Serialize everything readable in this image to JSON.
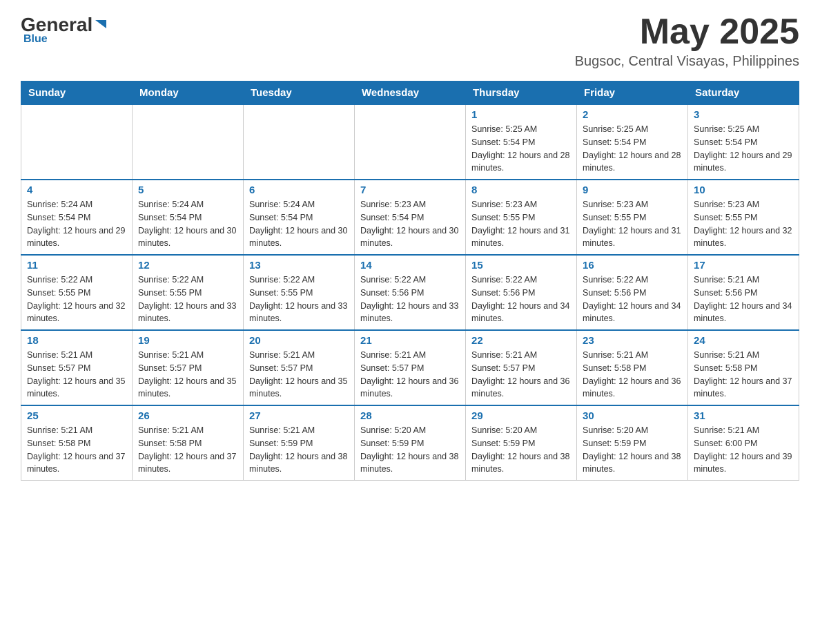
{
  "header": {
    "logo": {
      "general": "General",
      "triangle": "▶",
      "blue": "Blue"
    },
    "title": "May 2025",
    "location": "Bugsoc, Central Visayas, Philippines"
  },
  "days_of_week": [
    "Sunday",
    "Monday",
    "Tuesday",
    "Wednesday",
    "Thursday",
    "Friday",
    "Saturday"
  ],
  "weeks": [
    [
      {
        "day": "",
        "info": ""
      },
      {
        "day": "",
        "info": ""
      },
      {
        "day": "",
        "info": ""
      },
      {
        "day": "",
        "info": ""
      },
      {
        "day": "1",
        "sunrise": "5:25 AM",
        "sunset": "5:54 PM",
        "daylight": "12 hours and 28 minutes."
      },
      {
        "day": "2",
        "sunrise": "5:25 AM",
        "sunset": "5:54 PM",
        "daylight": "12 hours and 28 minutes."
      },
      {
        "day": "3",
        "sunrise": "5:25 AM",
        "sunset": "5:54 PM",
        "daylight": "12 hours and 29 minutes."
      }
    ],
    [
      {
        "day": "4",
        "sunrise": "5:24 AM",
        "sunset": "5:54 PM",
        "daylight": "12 hours and 29 minutes."
      },
      {
        "day": "5",
        "sunrise": "5:24 AM",
        "sunset": "5:54 PM",
        "daylight": "12 hours and 30 minutes."
      },
      {
        "day": "6",
        "sunrise": "5:24 AM",
        "sunset": "5:54 PM",
        "daylight": "12 hours and 30 minutes."
      },
      {
        "day": "7",
        "sunrise": "5:23 AM",
        "sunset": "5:54 PM",
        "daylight": "12 hours and 30 minutes."
      },
      {
        "day": "8",
        "sunrise": "5:23 AM",
        "sunset": "5:55 PM",
        "daylight": "12 hours and 31 minutes."
      },
      {
        "day": "9",
        "sunrise": "5:23 AM",
        "sunset": "5:55 PM",
        "daylight": "12 hours and 31 minutes."
      },
      {
        "day": "10",
        "sunrise": "5:23 AM",
        "sunset": "5:55 PM",
        "daylight": "12 hours and 32 minutes."
      }
    ],
    [
      {
        "day": "11",
        "sunrise": "5:22 AM",
        "sunset": "5:55 PM",
        "daylight": "12 hours and 32 minutes."
      },
      {
        "day": "12",
        "sunrise": "5:22 AM",
        "sunset": "5:55 PM",
        "daylight": "12 hours and 33 minutes."
      },
      {
        "day": "13",
        "sunrise": "5:22 AM",
        "sunset": "5:55 PM",
        "daylight": "12 hours and 33 minutes."
      },
      {
        "day": "14",
        "sunrise": "5:22 AM",
        "sunset": "5:56 PM",
        "daylight": "12 hours and 33 minutes."
      },
      {
        "day": "15",
        "sunrise": "5:22 AM",
        "sunset": "5:56 PM",
        "daylight": "12 hours and 34 minutes."
      },
      {
        "day": "16",
        "sunrise": "5:22 AM",
        "sunset": "5:56 PM",
        "daylight": "12 hours and 34 minutes."
      },
      {
        "day": "17",
        "sunrise": "5:21 AM",
        "sunset": "5:56 PM",
        "daylight": "12 hours and 34 minutes."
      }
    ],
    [
      {
        "day": "18",
        "sunrise": "5:21 AM",
        "sunset": "5:57 PM",
        "daylight": "12 hours and 35 minutes."
      },
      {
        "day": "19",
        "sunrise": "5:21 AM",
        "sunset": "5:57 PM",
        "daylight": "12 hours and 35 minutes."
      },
      {
        "day": "20",
        "sunrise": "5:21 AM",
        "sunset": "5:57 PM",
        "daylight": "12 hours and 35 minutes."
      },
      {
        "day": "21",
        "sunrise": "5:21 AM",
        "sunset": "5:57 PM",
        "daylight": "12 hours and 36 minutes."
      },
      {
        "day": "22",
        "sunrise": "5:21 AM",
        "sunset": "5:57 PM",
        "daylight": "12 hours and 36 minutes."
      },
      {
        "day": "23",
        "sunrise": "5:21 AM",
        "sunset": "5:58 PM",
        "daylight": "12 hours and 36 minutes."
      },
      {
        "day": "24",
        "sunrise": "5:21 AM",
        "sunset": "5:58 PM",
        "daylight": "12 hours and 37 minutes."
      }
    ],
    [
      {
        "day": "25",
        "sunrise": "5:21 AM",
        "sunset": "5:58 PM",
        "daylight": "12 hours and 37 minutes."
      },
      {
        "day": "26",
        "sunrise": "5:21 AM",
        "sunset": "5:58 PM",
        "daylight": "12 hours and 37 minutes."
      },
      {
        "day": "27",
        "sunrise": "5:21 AM",
        "sunset": "5:59 PM",
        "daylight": "12 hours and 38 minutes."
      },
      {
        "day": "28",
        "sunrise": "5:20 AM",
        "sunset": "5:59 PM",
        "daylight": "12 hours and 38 minutes."
      },
      {
        "day": "29",
        "sunrise": "5:20 AM",
        "sunset": "5:59 PM",
        "daylight": "12 hours and 38 minutes."
      },
      {
        "day": "30",
        "sunrise": "5:20 AM",
        "sunset": "5:59 PM",
        "daylight": "12 hours and 38 minutes."
      },
      {
        "day": "31",
        "sunrise": "5:21 AM",
        "sunset": "6:00 PM",
        "daylight": "12 hours and 39 minutes."
      }
    ]
  ],
  "labels": {
    "sunrise_prefix": "Sunrise: ",
    "sunset_prefix": "Sunset: ",
    "daylight_prefix": "Daylight: "
  }
}
